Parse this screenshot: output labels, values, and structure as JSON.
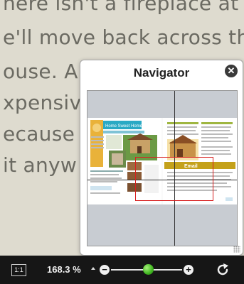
{
  "document": {
    "lines": [
      "here isn't a fireplace at th",
      "e'll move back across the",
      "ouse. An",
      "xpensive",
      "ecause I",
      "it anyw"
    ]
  },
  "navigator": {
    "title": "Navigator",
    "close_icon": "close-icon",
    "preview": {
      "left_page_title": "Home Sweet Home",
      "right_page_banner": "Email"
    }
  },
  "toolbar": {
    "fit_label": "1:1",
    "zoom_level": "168.3 %",
    "zoom_fraction": 0.52,
    "zoom_out_icon": "zoom-out-icon",
    "zoom_in_icon": "zoom-in-icon",
    "rotate_icon": "rotate-icon"
  },
  "colors": {
    "viewport_border": "#d82020",
    "slider_thumb": "#3fb51f",
    "toolbar_bg": "#161616"
  }
}
